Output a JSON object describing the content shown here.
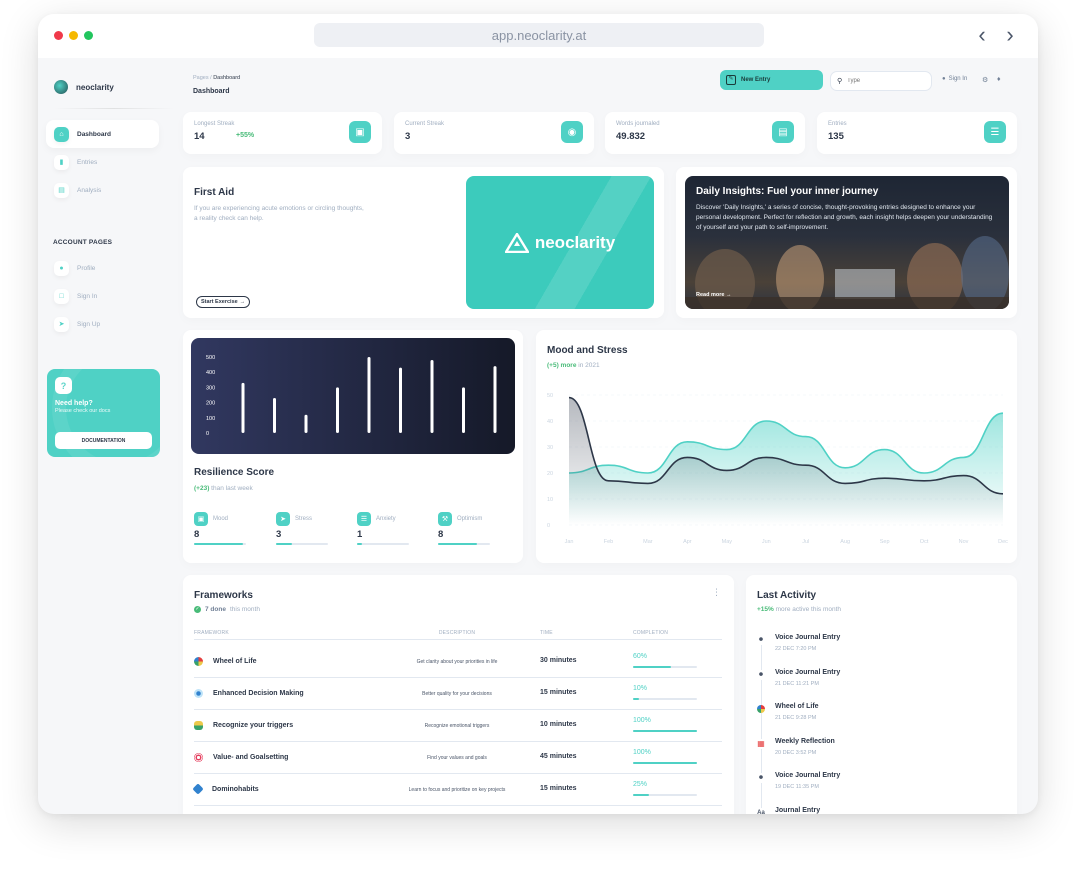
{
  "browser": {
    "url": "app.neoclarity.at",
    "back_icon": "chevron-left-icon",
    "forward_icon": "chevron-right-icon"
  },
  "sidebar": {
    "brand": "neoclarity",
    "items": [
      {
        "label": "Dashboard",
        "icon": "home-icon",
        "active": true
      },
      {
        "label": "Entries",
        "icon": "bar-chart-icon"
      },
      {
        "label": "Analysis",
        "icon": "card-icon"
      }
    ],
    "account_heading": "ACCOUNT PAGES",
    "account_items": [
      {
        "label": "Profile",
        "icon": "user-icon"
      },
      {
        "label": "Sign In",
        "icon": "document-icon"
      },
      {
        "label": "Sign Up",
        "icon": "rocket-icon"
      }
    ],
    "help": {
      "title": "Need help?",
      "subtitle": "Please check our docs",
      "button": "DOCUMENTATION"
    }
  },
  "header": {
    "breadcrumb_root": "Pages",
    "breadcrumb_sep": "/",
    "breadcrumb_current": "Dashboard",
    "title": "Dashboard",
    "new_entry": "New Entry",
    "search_placeholder": "Type",
    "sign_in": "Sign In"
  },
  "stats": [
    {
      "label": "Longest Streak",
      "value": "14",
      "delta": "+55%",
      "icon": "wallet-icon"
    },
    {
      "label": "Current Streak",
      "value": "3",
      "delta": "",
      "icon": "globe-icon"
    },
    {
      "label": "Words journaled",
      "value": "49.832",
      "delta": "",
      "icon": "document-icon"
    },
    {
      "label": "Entries",
      "value": "135",
      "delta": "",
      "icon": "cart-icon"
    }
  ],
  "first_aid": {
    "title": "First Aid",
    "text": "If you are experiencing acute emotions or circling thoughts, a reality check can help.",
    "button": "Start Exercise",
    "banner_brand": "neoclarity"
  },
  "insights": {
    "title": "Daily Insights: Fuel your inner journey",
    "text": "Discover 'Daily Insights,' a series of concise, thought-provoking entries designed to enhance your personal development. Perfect for reflection and growth, each insight helps deepen your understanding of yourself and your path to self-improvement.",
    "link": "Read more"
  },
  "resilience": {
    "title": "Resilience Score",
    "delta": "(+23)",
    "delta_suffix": "than last week",
    "chart_data": {
      "type": "bar",
      "y_ticks": [
        "500",
        "400",
        "300",
        "200",
        "100",
        "0"
      ],
      "ylim": [
        0,
        500
      ],
      "values": [
        330,
        230,
        120,
        300,
        500,
        430,
        480,
        300,
        440
      ]
    },
    "metrics": [
      {
        "label": "Mood",
        "value": "8",
        "progress": 0.95,
        "icon": "wallet-icon"
      },
      {
        "label": "Stress",
        "value": "3",
        "progress": 0.3,
        "icon": "rocket-icon"
      },
      {
        "label": "Anxiety",
        "value": "1",
        "progress": 0.1,
        "icon": "cart-icon"
      },
      {
        "label": "Optimism",
        "value": "8",
        "progress": 0.75,
        "icon": "wrench-icon"
      }
    ]
  },
  "mood": {
    "title": "Mood and Stress",
    "delta": "(+5) more",
    "delta_suffix": "in 2021",
    "chart_data": {
      "type": "area",
      "categories": [
        "Jan",
        "Feb",
        "Mar",
        "Apr",
        "May",
        "Jun",
        "Jul",
        "Aug",
        "Sep",
        "Oct",
        "Nov",
        "Dec"
      ],
      "ylim": [
        0,
        50
      ],
      "y_ticks": [
        "50",
        "40",
        "30",
        "20",
        "10",
        "0"
      ],
      "series": [
        {
          "values": [
            20,
            23,
            20,
            32,
            29,
            40,
            34,
            22,
            29,
            20,
            26,
            43
          ],
          "color": "#4fd1c5"
        },
        {
          "values": [
            49,
            17,
            16,
            26,
            21,
            26,
            23,
            16,
            18,
            17,
            19,
            12
          ],
          "color": "#2d3748"
        }
      ]
    }
  },
  "frameworks": {
    "title": "Frameworks",
    "done": "7 done",
    "done_suffix": "this month",
    "columns": [
      "FRAMEWORK",
      "DESCRIPTION",
      "TIME",
      "COMPLETION"
    ],
    "rows": [
      {
        "name": "Wheel of Life",
        "description": "Get clarity about your priorities in life",
        "time": "30 minutes",
        "completion": "60%",
        "progress": 0.6,
        "icon": "wheel-icon",
        "color": "#e53e3e"
      },
      {
        "name": "Enhanced Decision Making",
        "description": "Better quality for your decisions",
        "time": "15 minutes",
        "completion": "10%",
        "progress": 0.1,
        "icon": "nodes-icon",
        "color": "#3182ce"
      },
      {
        "name": "Recognize your triggers",
        "description": "Recognize emotional triggers",
        "time": "10 minutes",
        "completion": "100%",
        "progress": 1.0,
        "icon": "bulb-icon",
        "color": "#38a169"
      },
      {
        "name": "Value- and Goalsetting",
        "description": "Find your values and goals",
        "time": "45 minutes",
        "completion": "100%",
        "progress": 1.0,
        "icon": "target-icon",
        "color": "#e53e5e"
      },
      {
        "name": "Dominohabits",
        "description": "Learn to focus and prioritize on key projects",
        "time": "15 minutes",
        "completion": "25%",
        "progress": 0.25,
        "icon": "diamond-icon",
        "color": "#3182ce"
      }
    ]
  },
  "activity": {
    "title": "Last Activity",
    "delta": "+15%",
    "delta_suffix": "more active this month",
    "items": [
      {
        "name": "Voice Journal Entry",
        "date": "22 DEC 7:20 PM",
        "icon": "microphone-icon"
      },
      {
        "name": "Voice Journal Entry",
        "date": "21 DEC 11:21 PM",
        "icon": "microphone-icon"
      },
      {
        "name": "Wheel of Life",
        "date": "21 DEC 9:28 PM",
        "icon": "wheel-icon"
      },
      {
        "name": "Weekly Reflection",
        "date": "20 DEC 3:52 PM",
        "icon": "calendar-icon"
      },
      {
        "name": "Voice Journal Entry",
        "date": "19 DEC 11:35 PM",
        "icon": "microphone-icon"
      },
      {
        "name": "Journal Entry",
        "date": "",
        "icon": "text-icon"
      }
    ]
  }
}
